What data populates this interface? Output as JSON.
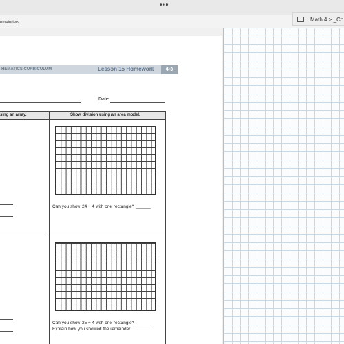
{
  "window": {
    "dots": "•••",
    "breadcrumb": "emainders"
  },
  "tab": {
    "label": "Math 4 > _Co"
  },
  "worksheet": {
    "header_left": "HEMATICS CURRICULUM",
    "header_title": "Lesson 15 Homework",
    "header_badge": "4•3",
    "date_label": "Date",
    "col_left": "sing an array.",
    "col_right": "Show division using an area model.",
    "q1": "Can you show 24 ÷ 4 with one rectangle? ______",
    "q2": "Can you show 25 ÷ 4 with one rectangle? ______",
    "q2_explain": "Explain how you showed the remainder:"
  },
  "colors": {
    "grid_lines": "#c9d8e6",
    "header_bg": "#cfd6dd",
    "badge_bg": "#9aa6b2"
  }
}
